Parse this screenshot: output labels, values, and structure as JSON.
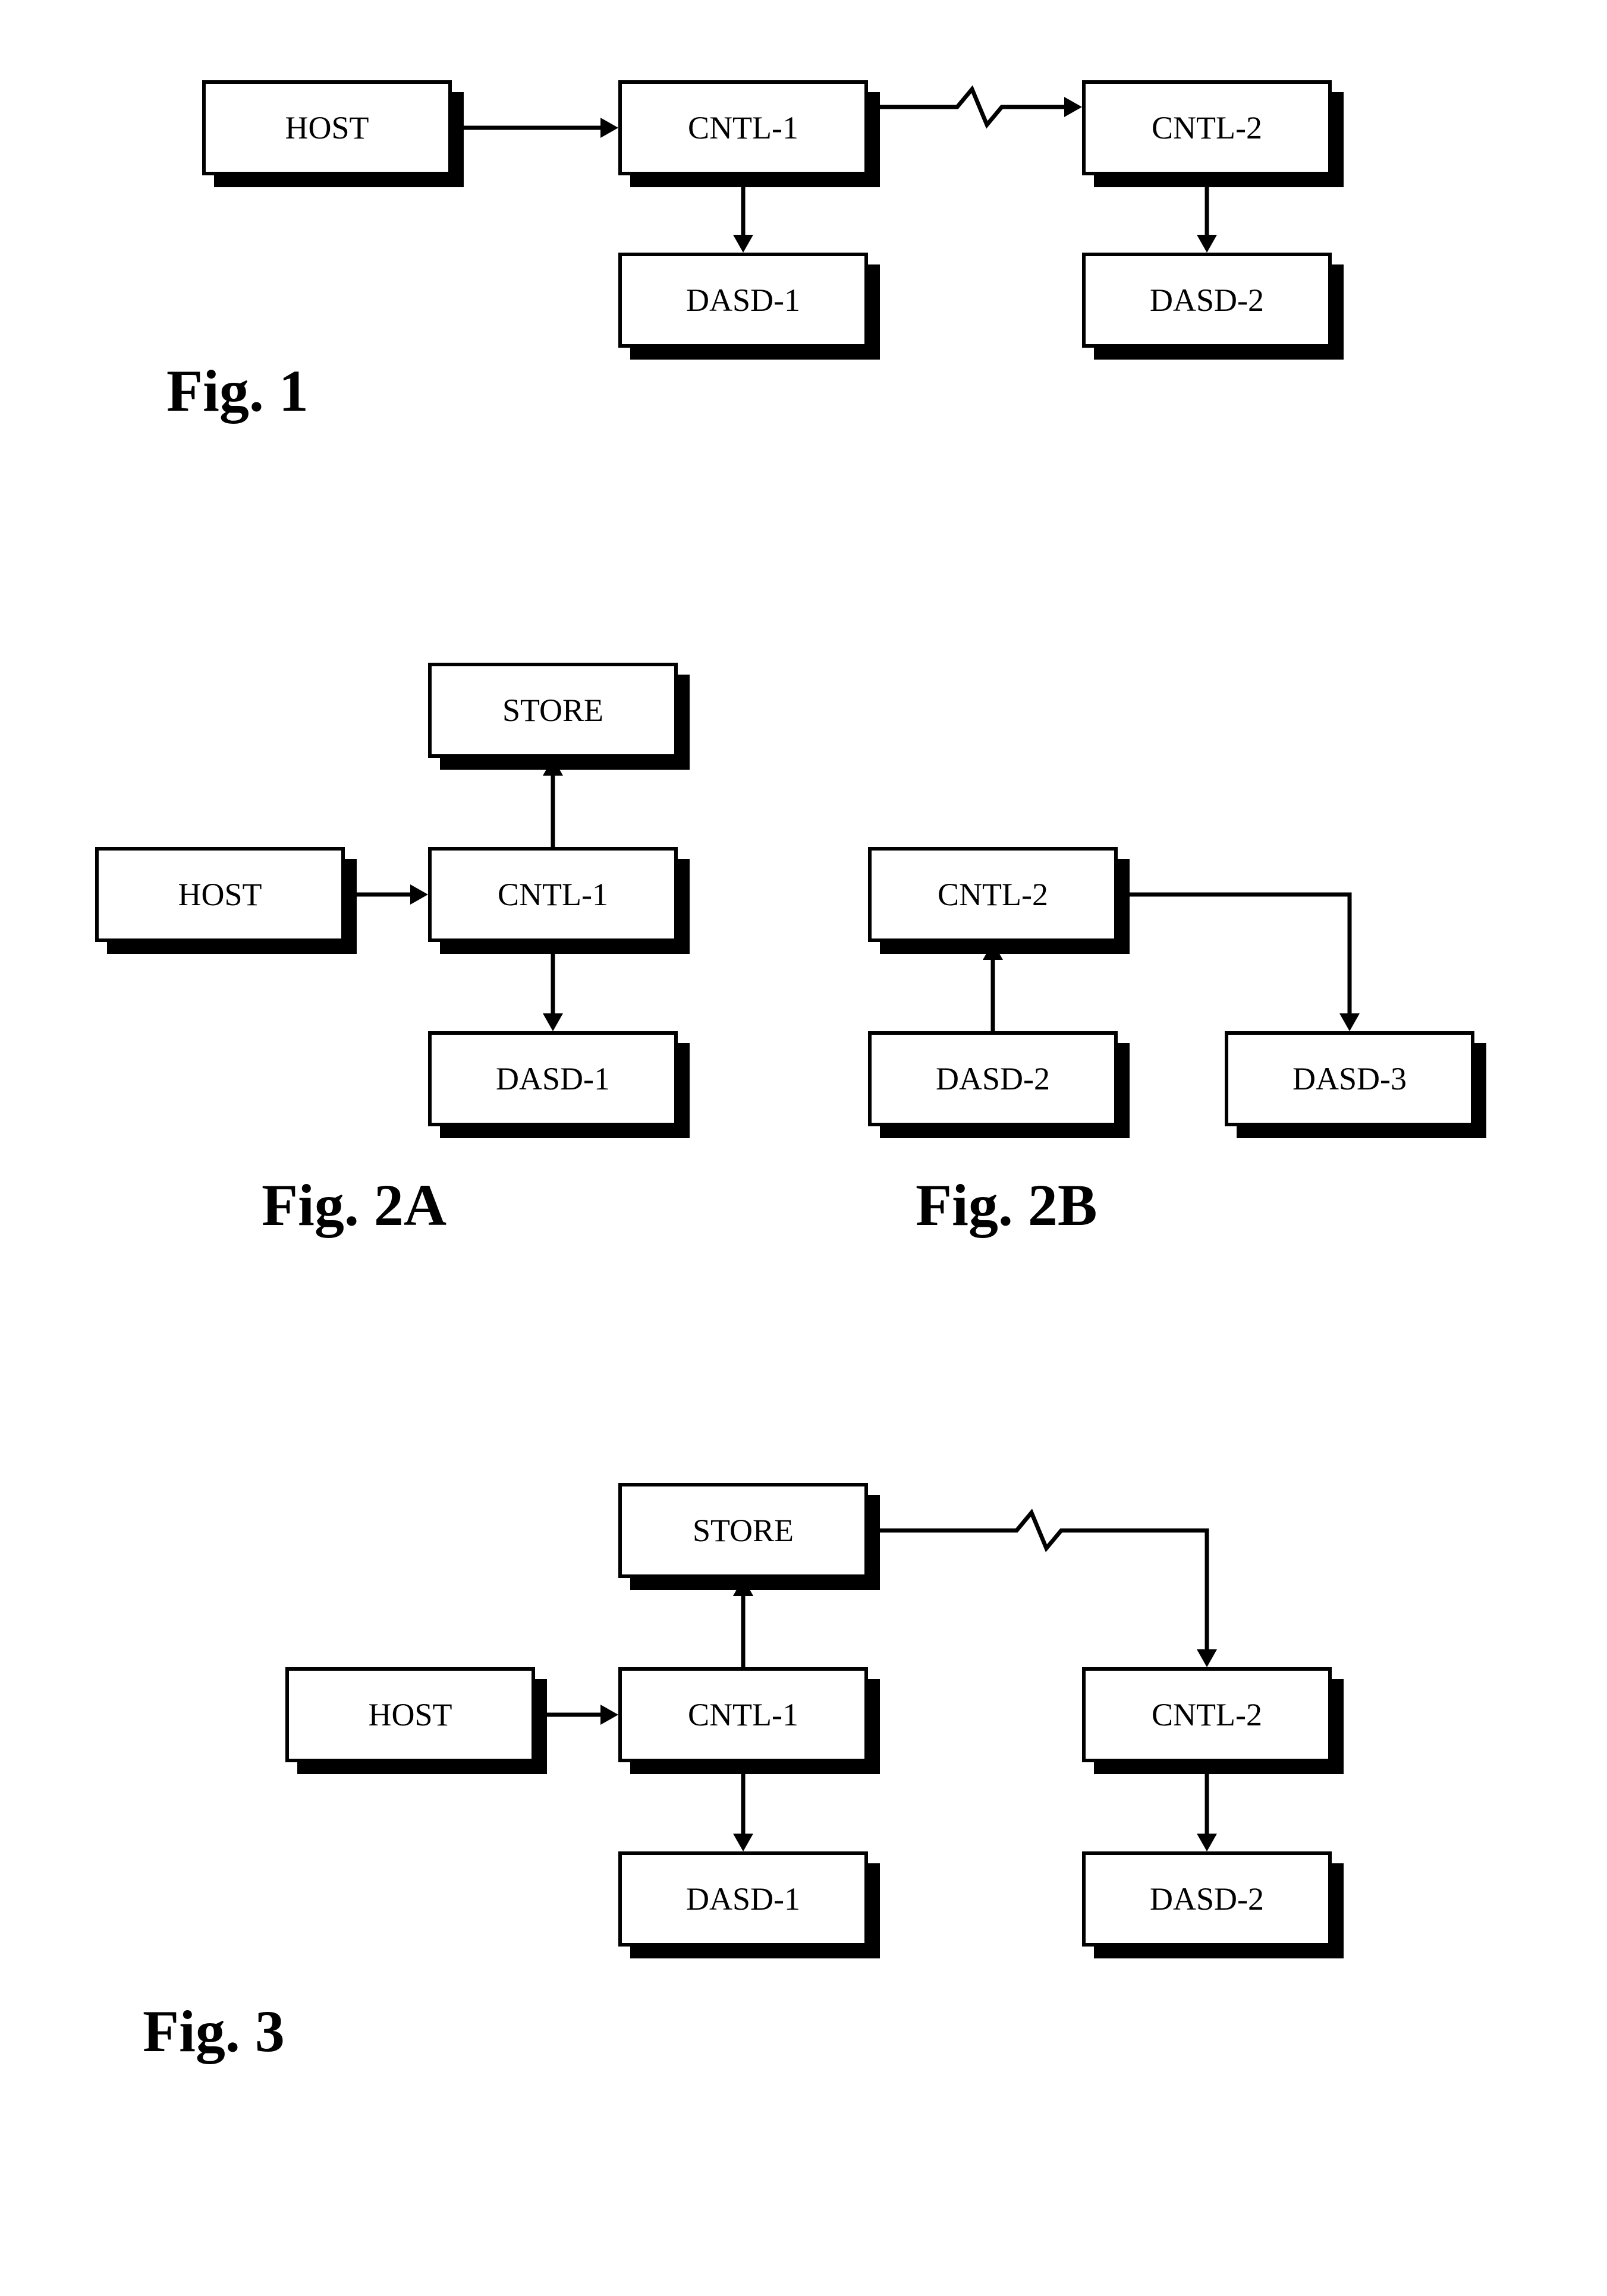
{
  "fig1": {
    "caption": "Fig. 1",
    "host": "HOST",
    "cntl1": "CNTL-1",
    "cntl2": "CNTL-2",
    "dasd1": "DASD-1",
    "dasd2": "DASD-2"
  },
  "fig2a": {
    "caption": "Fig. 2A",
    "host": "HOST",
    "cntl1": "CNTL-1",
    "store": "STORE",
    "dasd1": "DASD-1"
  },
  "fig2b": {
    "caption": "Fig. 2B",
    "cntl2": "CNTL-2",
    "dasd2": "DASD-2",
    "dasd3": "DASD-3"
  },
  "fig3": {
    "caption": "Fig. 3",
    "host": "HOST",
    "cntl1": "CNTL-1",
    "store": "STORE",
    "cntl2": "CNTL-2",
    "dasd1": "DASD-1",
    "dasd2": "DASD-2"
  }
}
